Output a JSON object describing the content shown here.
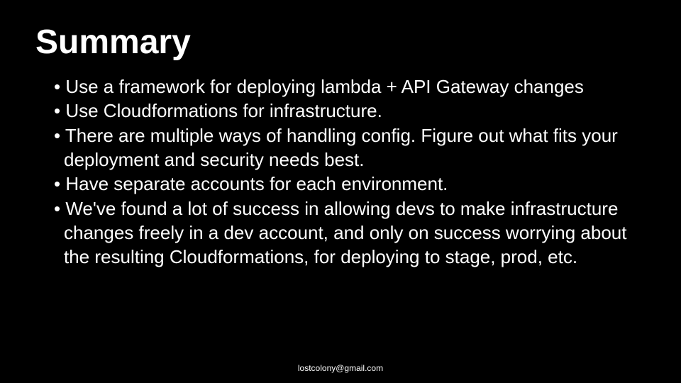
{
  "title": "Summary",
  "bullets": [
    "Use a framework for deploying lambda + API Gateway changes",
    "Use Cloudformations for infrastructure.",
    "There are multiple ways of handling config. Figure out what fits your deployment and security needs best.",
    "Have separate accounts for each environment.",
    "We've found a lot of success in allowing devs to make infrastructure changes freely in a dev account, and only on success worrying about the resulting Cloudformations, for deploying to stage, prod, etc."
  ],
  "footer": "lostcolony@gmail.com"
}
